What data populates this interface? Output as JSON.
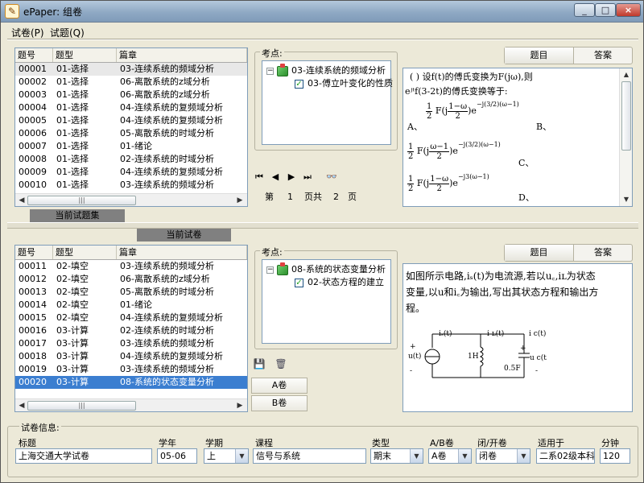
{
  "window": {
    "title": "ePaper: 组卷",
    "min": "_",
    "max": "□",
    "close": "×"
  },
  "menu": [
    {
      "label": "试卷(P)"
    },
    {
      "label": "试题(Q)"
    }
  ],
  "top_grid": {
    "headers": [
      "题号",
      "题型",
      "篇章"
    ],
    "rows": [
      [
        "00001",
        "01-选择",
        "03-连续系统的频域分析"
      ],
      [
        "00002",
        "01-选择",
        "06-离散系统的z域分析"
      ],
      [
        "00003",
        "01-选择",
        "06-离散系统的z域分析"
      ],
      [
        "00004",
        "01-选择",
        "04-连续系统的复频域分析"
      ],
      [
        "00005",
        "01-选择",
        "04-连续系统的复频域分析"
      ],
      [
        "00006",
        "01-选择",
        "05-离散系统的时域分析"
      ],
      [
        "00007",
        "01-选择",
        "01-绪论"
      ],
      [
        "00008",
        "01-选择",
        "02-连续系统的时域分析"
      ],
      [
        "00009",
        "01-选择",
        "04-连续系统的复频域分析"
      ],
      [
        "00010",
        "01-选择",
        "03-连续系统的频域分析"
      ]
    ]
  },
  "top_points": {
    "title": "考点:",
    "chapter": "03-连续系统的频域分析",
    "item": "03-傅立叶变化的性质"
  },
  "nav": {
    "first": "⏮",
    "prev": "◀",
    "next": "▶",
    "last": "⏭",
    "find": "👓",
    "page_prefix": "第",
    "page": "1",
    "page_mid": "页共",
    "total": "2",
    "page_suffix": "页"
  },
  "top_tabs": {
    "question": "题目",
    "answer": "答案"
  },
  "top_question": {
    "line1": "(    )  设f(t)的傅氏变换为F(jω),则",
    "line2": "eʲᵗf(3-2t)的傅氏变换等于:",
    "optA": "A、",
    "optB": "B、",
    "optC": "C、",
    "optD": "D、",
    "half": "1",
    "two": "2",
    "F": "F(j",
    "fracA_num": "1−ω",
    "fracB_num": "ω−1",
    "fracD_num": "1−ω",
    "den": "2",
    "close": ")e",
    "expA": "−j(3/2)(ω−1)",
    "expB": "−j(3/2)(ω−1)",
    "expD": "−j3(ω−1)"
  },
  "labels": {
    "current_set": "当前试题集",
    "current_paper": "当前试卷"
  },
  "bottom_grid": {
    "headers": [
      "题号",
      "题型",
      "篇章"
    ],
    "rows": [
      [
        "00011",
        "02-填空",
        "03-连续系统的频域分析"
      ],
      [
        "00012",
        "02-填空",
        "06-离散系统的z域分析"
      ],
      [
        "00013",
        "02-填空",
        "05-离散系统的时域分析"
      ],
      [
        "00014",
        "02-填空",
        "01-绪论"
      ],
      [
        "00015",
        "02-填空",
        "04-连续系统的复频域分析"
      ],
      [
        "00016",
        "03-计算",
        "02-连续系统的时域分析"
      ],
      [
        "00017",
        "03-计算",
        "03-连续系统的频域分析"
      ],
      [
        "00018",
        "03-计算",
        "04-连续系统的复频域分析"
      ],
      [
        "00019",
        "03-计算",
        "03-连续系统的频域分析"
      ],
      [
        "00020",
        "03-计算",
        "08-系统的状态变量分析"
      ]
    ],
    "selected_index": 9
  },
  "bottom_points": {
    "title": "考点:",
    "chapter": "08-系统的状态变量分析",
    "item": "02-状态方程的建立"
  },
  "tools": {
    "save": "💾",
    "delete": "🗑"
  },
  "ab_buttons": {
    "a": "A卷",
    "b": "B卷"
  },
  "bottom_tabs": {
    "question": "题目",
    "answer": "答案"
  },
  "bottom_question": {
    "line1": "如图所示电路,iₛ(t)为电流源,若以u꜀,iʟ为状态",
    "line2": "变量,以u和i꜀为输出,写出其状态方程和输出方",
    "line3": "程。",
    "circuit": {
      "is": "iₛ(t)",
      "il": "i ʟ(t)",
      "ic": "i c(t)",
      "u": "u(t)",
      "uc": "u c(t)",
      "L": "1H",
      "C": "0.5F",
      "plus": "+",
      "minus": "-"
    }
  },
  "paper_info": {
    "title": "试卷信息:",
    "fields": {
      "title_label": "标题",
      "title_value": "上海交通大学试卷",
      "year_label": "学年",
      "year_value": "05-06",
      "term_label": "学期",
      "term_value": "上",
      "course_label": "课程",
      "course_value": "信号与系统",
      "type_label": "类型",
      "type_value": "期末",
      "ab_label": "A/B卷",
      "ab_value": "A卷",
      "open_label": "闭/开卷",
      "open_value": "闭卷",
      "for_label": "适用于",
      "for_value": "二系02级本科",
      "minutes_label": "分钟",
      "minutes_value": "120"
    }
  }
}
